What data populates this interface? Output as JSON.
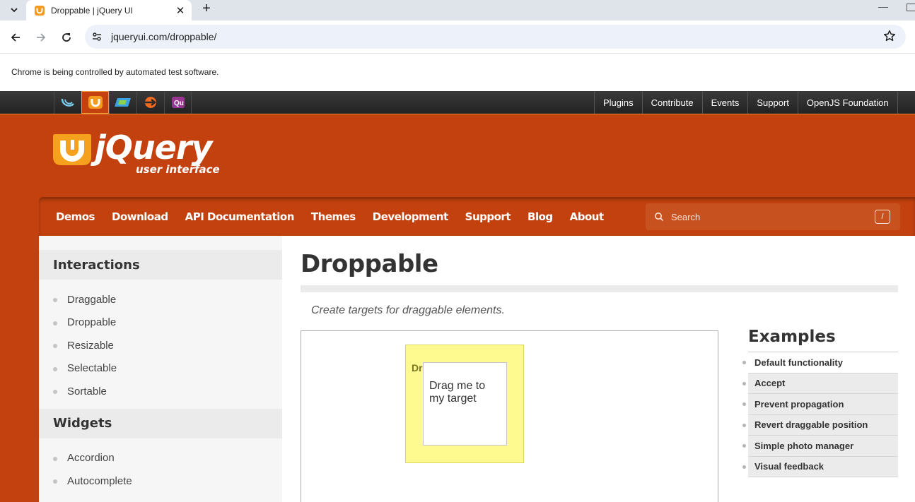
{
  "browser": {
    "tab_title": "Droppable | jQuery UI",
    "url": "jqueryui.com/droppable/",
    "infobar_text": "Chrome is being controlled by automated test software."
  },
  "globalbar": {
    "project_icons": [
      "jquery-swirl-icon",
      "jquery-ui-icon",
      "jquery-mobile-icon",
      "sizzle-icon",
      "qunit-icon"
    ],
    "links": [
      "Plugins",
      "Contribute",
      "Events",
      "Support",
      "OpenJS Foundation"
    ]
  },
  "header": {
    "logo_text": "jQuery",
    "logo_subtext": "user interface"
  },
  "mainnav": {
    "items": [
      "Demos",
      "Download",
      "API Documentation",
      "Themes",
      "Development",
      "Support",
      "Blog",
      "About"
    ],
    "search_placeholder": "Search",
    "search_shortcut": "/"
  },
  "sidebar": {
    "sections": [
      {
        "title": "Interactions",
        "items": [
          "Draggable",
          "Droppable",
          "Resizable",
          "Selectable",
          "Sortable"
        ]
      },
      {
        "title": "Widgets",
        "items": [
          "Accordion",
          "Autocomplete"
        ]
      }
    ]
  },
  "main": {
    "title": "Droppable",
    "subtitle": "Create targets for draggable elements.",
    "demo": {
      "droppable_text": "Drop here",
      "draggable_text": "Drag me to my target"
    },
    "examples_title": "Examples",
    "examples": [
      "Default functionality",
      "Accept",
      "Prevent propagation",
      "Revert draggable position",
      "Simple photo manager",
      "Visual feedback"
    ]
  },
  "colors": {
    "brand_orange": "#c2410f",
    "highlight_yellow": "#fffa90"
  }
}
